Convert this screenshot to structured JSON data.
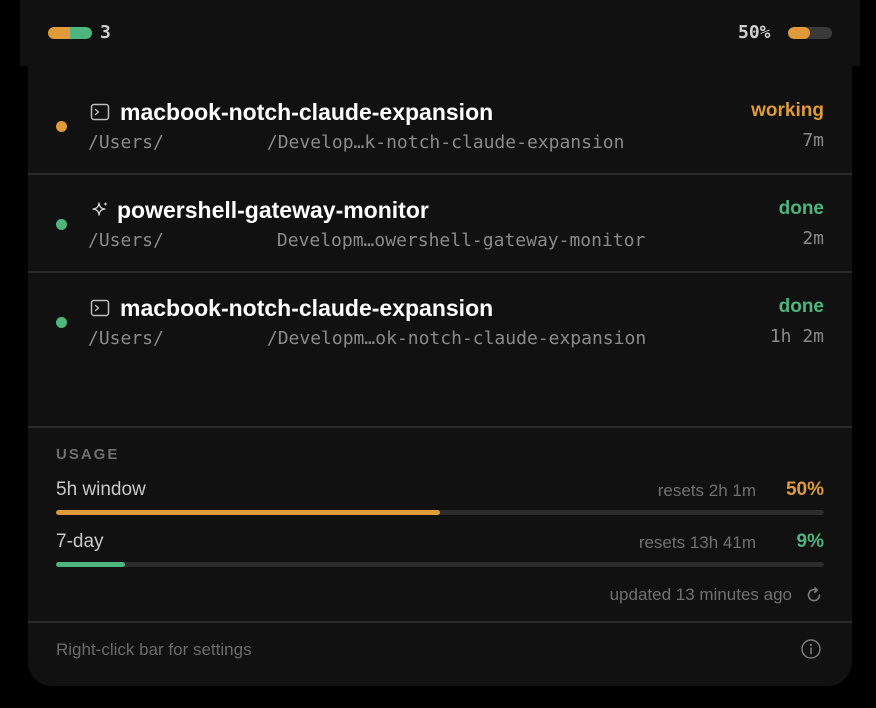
{
  "top_bar": {
    "session_count": "3",
    "usage_percent_label": "50%",
    "usage_fraction": 0.5,
    "count_pill_colors": [
      "#e09a3a",
      "#4db57d"
    ]
  },
  "colors": {
    "working": "#e09a3a",
    "done": "#4db57d"
  },
  "sessions": [
    {
      "icon": "terminal-icon",
      "title": "macbook-notch-claude-expansion",
      "path_start": "/Users/",
      "path_end": "/Develop…k-notch-claude-expansion",
      "status": "working",
      "elapsed": "7m"
    },
    {
      "icon": "sparkle-icon",
      "title": "powershell-gateway-monitor",
      "path_start": "/Users/",
      "path_end": "Developm…owershell-gateway-monitor",
      "status": "done",
      "elapsed": "2m"
    },
    {
      "icon": "terminal-icon",
      "title": "macbook-notch-claude-expansion",
      "path_start": "/Users/",
      "path_end": "/Developm…ok-notch-claude-expansion",
      "status": "done",
      "elapsed": "1h 2m"
    }
  ],
  "usage": {
    "heading": "USAGE",
    "windows": [
      {
        "label": "5h window",
        "resets": "resets 2h 1m",
        "percent_label": "50%",
        "fraction": 0.5,
        "color": "#e09a3a"
      },
      {
        "label": "7-day",
        "resets": "resets 13h 41m",
        "percent_label": "9%",
        "fraction": 0.09,
        "color": "#4db57d"
      }
    ],
    "updated": "updated 13 minutes ago",
    "refresh_icon": "refresh-icon"
  },
  "footer": {
    "hint": "Right-click bar for settings",
    "info_icon": "info-icon"
  }
}
